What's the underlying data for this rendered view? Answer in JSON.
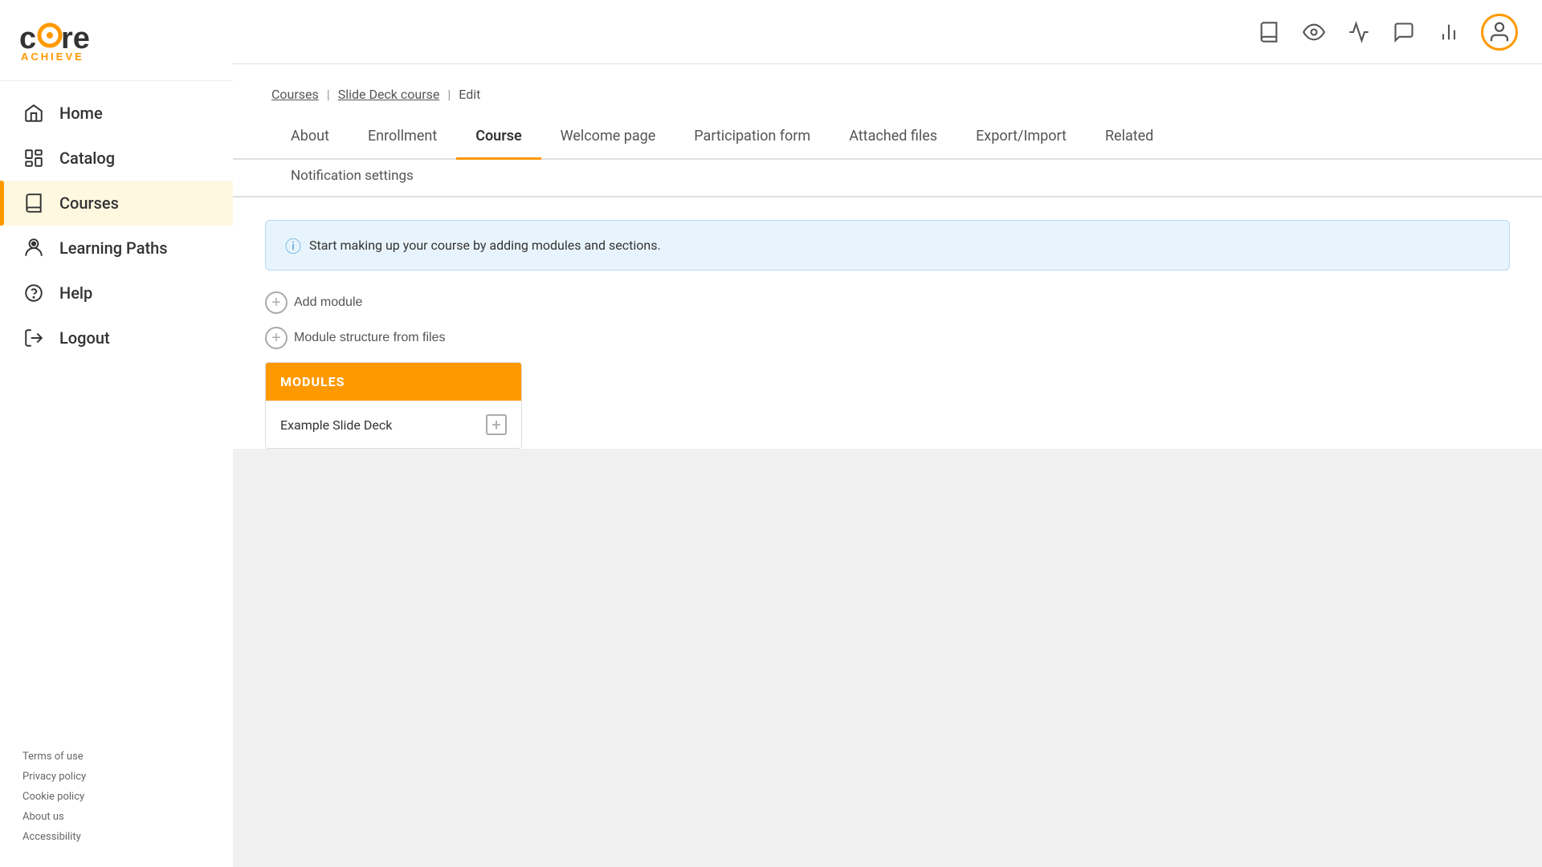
{
  "logo": {
    "core": "c re",
    "achieve": "ACHIEVE"
  },
  "sidebar": {
    "items": [
      {
        "id": "home",
        "label": "Home",
        "icon": "home-icon",
        "active": false
      },
      {
        "id": "catalog",
        "label": "Catalog",
        "icon": "catalog-icon",
        "active": false
      },
      {
        "id": "courses",
        "label": "Courses",
        "icon": "courses-icon",
        "active": true
      },
      {
        "id": "learning-paths",
        "label": "Learning Paths",
        "icon": "learning-paths-icon",
        "active": false
      },
      {
        "id": "help",
        "label": "Help",
        "icon": "help-icon",
        "active": false
      },
      {
        "id": "logout",
        "label": "Logout",
        "icon": "logout-icon",
        "active": false
      }
    ],
    "footer_links": [
      "Terms of use",
      "Privacy policy",
      "Cookie policy",
      "About us",
      "Accessibility"
    ]
  },
  "breadcrumb": {
    "links": [
      "Courses",
      "Slide Deck course"
    ],
    "current": "Edit"
  },
  "tabs_row1": [
    {
      "id": "about",
      "label": "About",
      "active": false
    },
    {
      "id": "enrollment",
      "label": "Enrollment",
      "active": false
    },
    {
      "id": "course",
      "label": "Course",
      "active": true
    },
    {
      "id": "welcome-page",
      "label": "Welcome page",
      "active": false
    },
    {
      "id": "participation-form",
      "label": "Participation form",
      "active": false
    },
    {
      "id": "attached-files",
      "label": "Attached files",
      "active": false
    },
    {
      "id": "export-import",
      "label": "Export/Import",
      "active": false
    },
    {
      "id": "related",
      "label": "Related",
      "active": false
    }
  ],
  "tabs_row2": [
    {
      "id": "notification-settings",
      "label": "Notification settings",
      "active": false
    }
  ],
  "banner": {
    "message": "Start making up your course by adding modules and sections."
  },
  "actions": {
    "add_module": "Add module",
    "module_structure": "Module structure from files"
  },
  "module": {
    "header": "MODULES",
    "items": [
      {
        "label": "Example Slide Deck"
      }
    ]
  }
}
